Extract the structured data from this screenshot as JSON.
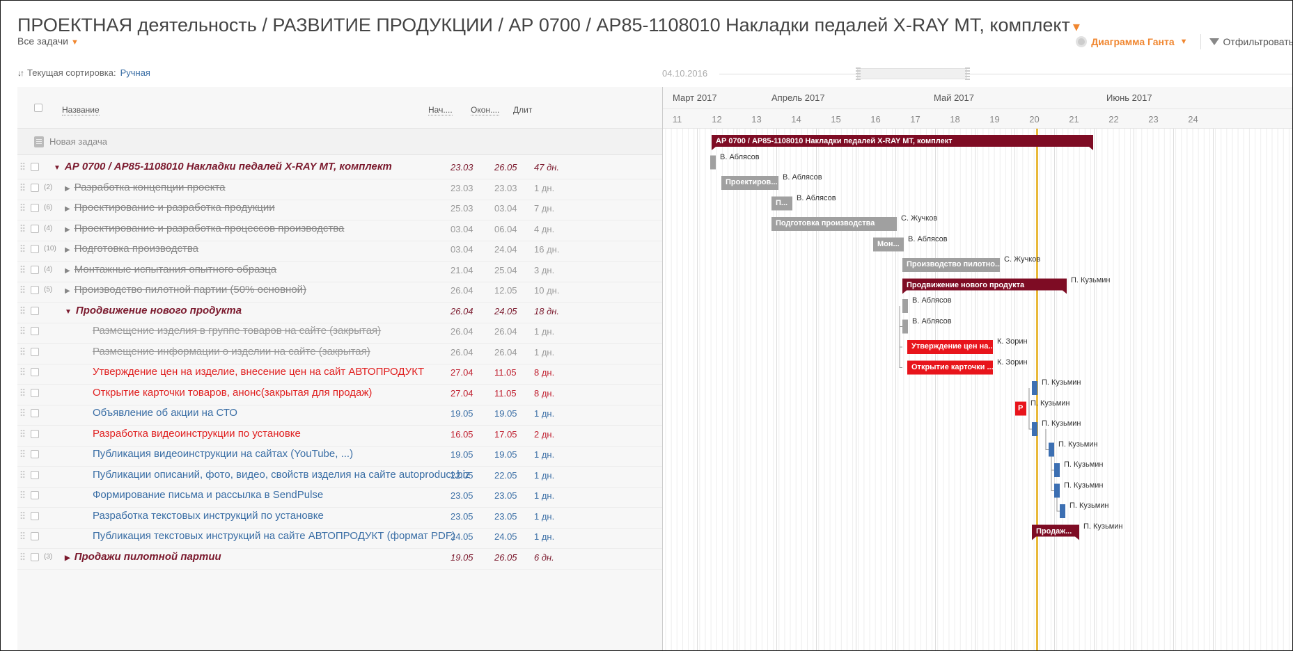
{
  "header": {
    "title": "ПРОЕКТНАЯ деятельность / РАЗВИТИЕ ПРОДУКЦИИ / АР 0700 / АР85-1108010 Накладки педалей X-RAY MT, комплект",
    "all_tasks": "Все задачи",
    "gantt_button": "Диаграмма Ганта",
    "filter_button": "Отфильтровать"
  },
  "sortbar": {
    "label": "Текущая сортировка:",
    "value": "Ручная"
  },
  "timeline": {
    "date": "04.10.2016"
  },
  "table": {
    "col_name": "Название",
    "col_start": "Нач....",
    "col_end": "Окон....",
    "col_dur": "Длит",
    "new_task": "Новая задача"
  },
  "rows": [
    {
      "count": "",
      "name": "АР 0700 / АР85-1108010 Накладки педалей X-RAY MT, комплект",
      "start": "23.03",
      "end": "26.05",
      "dur": "47 дн."
    },
    {
      "count": "(2)",
      "name": "Разработка концепции проекта",
      "start": "23.03",
      "end": "23.03",
      "dur": "1 дн."
    },
    {
      "count": "(6)",
      "name": "Проектирование и разработка продукции",
      "start": "25.03",
      "end": "03.04",
      "dur": "7 дн."
    },
    {
      "count": "(4)",
      "name": "Проектирование и разработка процессов производства",
      "start": "03.04",
      "end": "06.04",
      "dur": "4 дн."
    },
    {
      "count": "(10)",
      "name": "Подготовка производства",
      "start": "03.04",
      "end": "24.04",
      "dur": "16 дн."
    },
    {
      "count": "(4)",
      "name": "Монтажные испытания опытного образца",
      "start": "21.04",
      "end": "25.04",
      "dur": "3 дн."
    },
    {
      "count": "(5)",
      "name": "Производство пилотной партии (50% основной)",
      "start": "26.04",
      "end": "12.05",
      "dur": "10 дн."
    },
    {
      "count": "",
      "name": "Продвижение нового продукта",
      "start": "26.04",
      "end": "24.05",
      "dur": "18 дн."
    },
    {
      "count": "",
      "name": "Размещение изделия в группе товаров на сайте (закрытая)",
      "start": "26.04",
      "end": "26.04",
      "dur": "1 дн."
    },
    {
      "count": "",
      "name": "Размещение информации о изделии на сайте (закрытая)",
      "start": "26.04",
      "end": "26.04",
      "dur": "1 дн."
    },
    {
      "count": "",
      "name": "Утверждение цен на изделие, внесение цен на сайт АВТОПРОДУКТ",
      "start": "27.04",
      "end": "11.05",
      "dur": "8 дн."
    },
    {
      "count": "",
      "name": "Открытие карточки товаров, анонс(закрытая для продаж)",
      "start": "27.04",
      "end": "11.05",
      "dur": "8 дн."
    },
    {
      "count": "",
      "name": "Объявление об акции на СТО",
      "start": "19.05",
      "end": "19.05",
      "dur": "1 дн."
    },
    {
      "count": "",
      "name": "Разработка видеоинструкции по установке",
      "start": "16.05",
      "end": "17.05",
      "dur": "2 дн."
    },
    {
      "count": "",
      "name": "Публикация видеоинструкции на сайтах (YouTube, ...)",
      "start": "19.05",
      "end": "19.05",
      "dur": "1 дн."
    },
    {
      "count": "",
      "name": "Публикации описаний, фото, видео, свойств изделия на сайте autoproduct.biz",
      "start": "22.05",
      "end": "22.05",
      "dur": "1 дн."
    },
    {
      "count": "",
      "name": "Формирование письма и рассылка в SendPulse",
      "start": "23.05",
      "end": "23.05",
      "dur": "1 дн."
    },
    {
      "count": "",
      "name": "Разработка текстовых инструкций по установке",
      "start": "23.05",
      "end": "23.05",
      "dur": "1 дн."
    },
    {
      "count": "",
      "name": "Публикация текстовых инструкций на сайте АВТОПРОДУКТ (формат PDF)",
      "start": "24.05",
      "end": "24.05",
      "dur": "1 дн."
    },
    {
      "count": "(3)",
      "name": "Продажи пилотной партии",
      "start": "19.05",
      "end": "26.05",
      "dur": "6 дн."
    }
  ],
  "gantt": {
    "months": [
      "Март 2017",
      "Апрель 2017",
      "Май 2017",
      "Июнь 2017"
    ],
    "weeks": [
      "11",
      "12",
      "13",
      "14",
      "15",
      "16",
      "17",
      "18",
      "19",
      "20",
      "21",
      "22",
      "23",
      "24"
    ],
    "bar_labels": [
      "АР 0700 / АР85-1108010 Накладки педалей X-RAY MT, комплект",
      "Проектиров...",
      "П...",
      "Подготовка производства",
      "Мон...",
      "Производство пилотно...",
      "Продвижение нового продукта",
      "Утверждение цен на...",
      "Открытие карточки ...",
      "Р",
      "Продаж..."
    ],
    "owners": [
      "В. Аблясов",
      "В. Аблясов",
      "В. Аблясов",
      "С. Жучков",
      "В. Аблясов",
      "С. Жучков",
      "П. Кузьмин",
      "В. Аблясов",
      "В. Аблясов",
      "К. Зорин",
      "К. Зорин",
      "П. Кузьмин",
      "П. Кузьмин",
      "П. Кузьмин",
      "П. Кузьмин",
      "П. Кузьмин",
      "П. Кузьмин",
      "П. Кузьмин",
      "П. Кузьмин"
    ]
  },
  "colors": {
    "accent": "#f0862f",
    "project": "#7b1a2e",
    "summary_bar": "#7e0c24",
    "done_bar": "#a0a0a0",
    "urgent_bar": "#e8141b",
    "task_bar": "#3c6fb2",
    "today_line": "#e9b93a"
  }
}
